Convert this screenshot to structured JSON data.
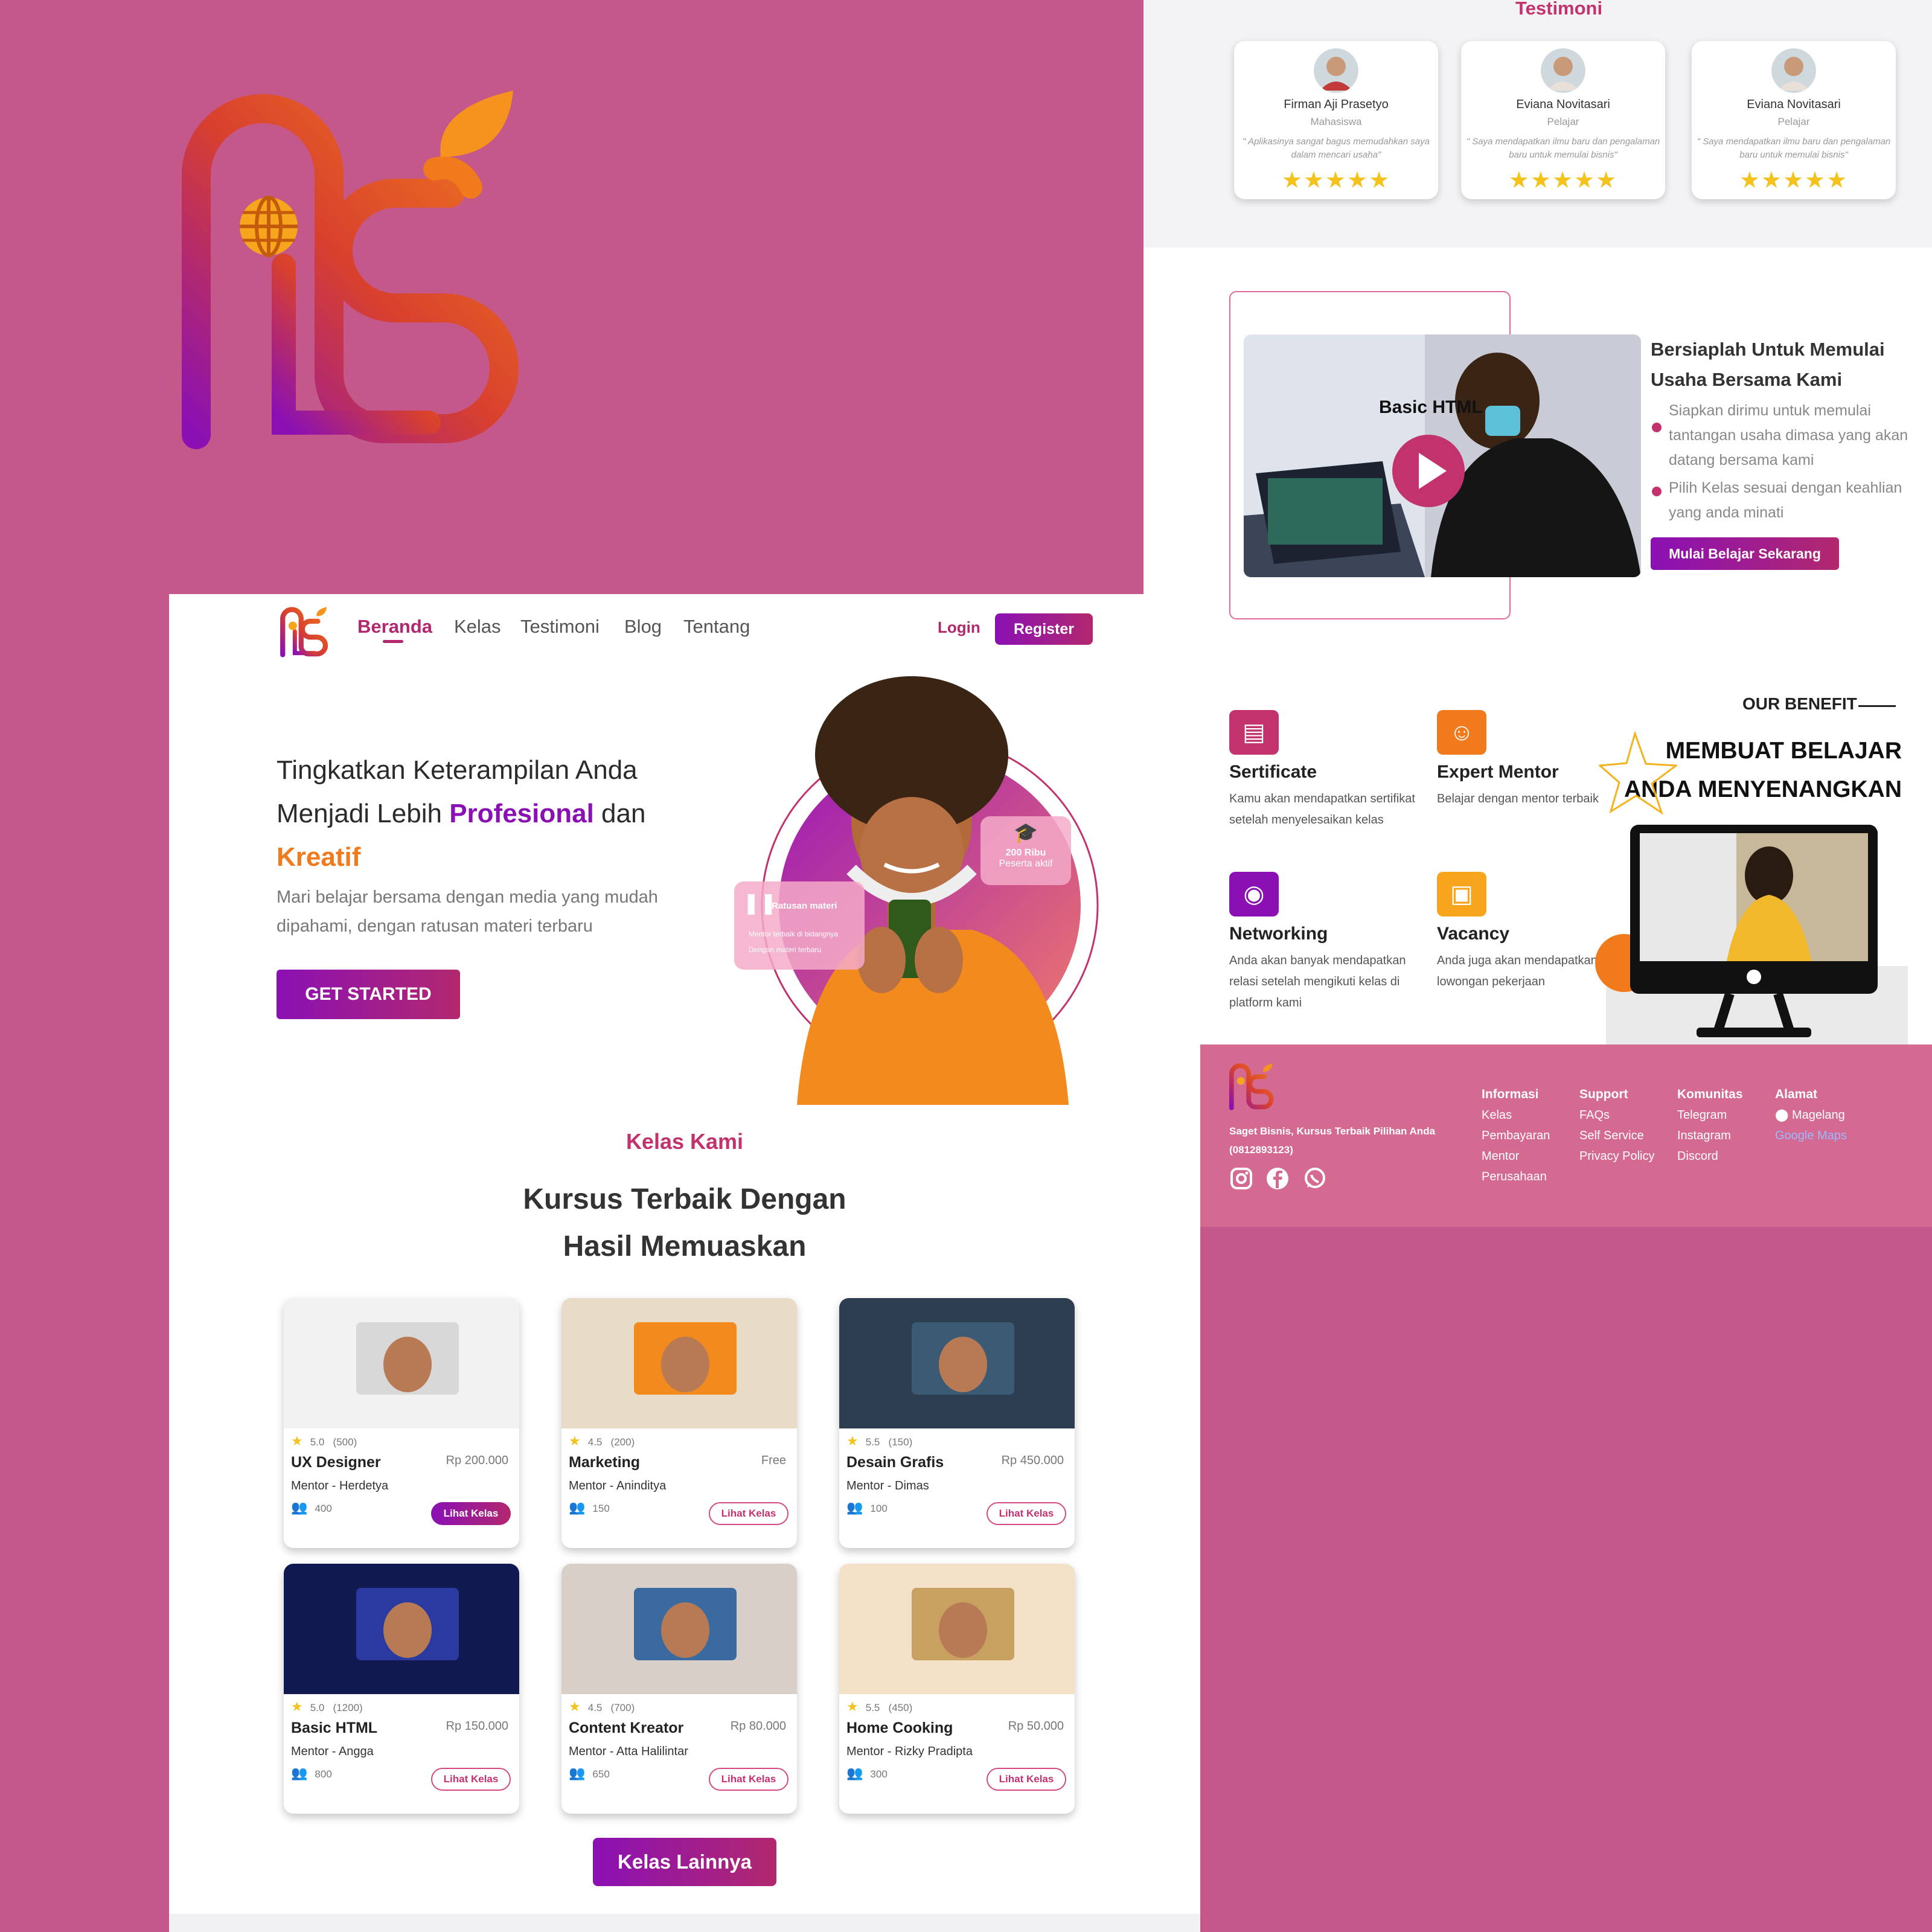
{
  "nav": {
    "items": [
      {
        "label": "Beranda",
        "active": true
      },
      {
        "label": "Kelas",
        "active": false
      },
      {
        "label": "Testimoni",
        "active": false
      },
      {
        "label": "Blog",
        "active": false
      },
      {
        "label": "Tentang",
        "active": false
      }
    ],
    "login": "Login",
    "register": "Register"
  },
  "hero": {
    "title_1": "Tingkatkan Keterampilan Anda",
    "title_2": "Menjadi Lebih ",
    "title_highlight_1": "Profesional",
    "title_3": " dan",
    "title_highlight_2": "Kreatif",
    "subtitle": "Mari  belajar bersama dengan media yang mudah dipahami, dengan ratusan materi terbaru",
    "cta": "GET STARTED",
    "float_materi": {
      "title": "Ratusan materi",
      "items": [
        "Mentor terbaik di bidangnya",
        "Dengan materi terbaru"
      ]
    },
    "float_peserta": {
      "title": "200 Ribu",
      "subtitle": "Peserta aktif"
    }
  },
  "kelas": {
    "kicker": "Kelas Kami",
    "title_1": "Kursus Terbaik Dengan",
    "title_2": "Hasil Memuaskan",
    "courses": [
      {
        "rating": "5.0",
        "reviews": "(500)",
        "name": "UX Designer",
        "price": "Rp 200.000",
        "mentor": "Mentor - Herdetya",
        "students": "400",
        "button": "Lihat Kelas"
      },
      {
        "rating": "4.5",
        "reviews": "(200)",
        "name": "Marketing",
        "price": "Free",
        "mentor": "Mentor - Aninditya",
        "students": "150",
        "button": "Lihat Kelas"
      },
      {
        "rating": "5.5",
        "reviews": "(150)",
        "name": "Desain Grafis",
        "price": "Rp 450.000",
        "mentor": "Mentor - Dimas",
        "students": "100",
        "button": "Lihat Kelas"
      },
      {
        "rating": "5.0",
        "reviews": "(1200)",
        "name": "Basic HTML",
        "price": "Rp 150.000",
        "mentor": "Mentor - Angga",
        "students": "800",
        "button": "Lihat Kelas"
      },
      {
        "rating": "4.5",
        "reviews": "(700)",
        "name": "Content Kreator",
        "price": "Rp 80.000",
        "mentor": "Mentor - Atta Halilintar",
        "students": "650",
        "button": "Lihat Kelas"
      },
      {
        "rating": "5.5",
        "reviews": "(450)",
        "name": "Home Cooking",
        "price": "Rp 50.000",
        "mentor": "Mentor - Rizky Pradipta",
        "students": "300",
        "button": "Lihat Kelas"
      }
    ],
    "more": "Kelas Lainnya"
  },
  "testimoni": {
    "heading": "Testimoni",
    "items": [
      {
        "name": "Firman Aji Prasetyo",
        "role": "Mahasiswa",
        "quote": "\" Aplikasinya sangat bagus memudahkan saya dalam mencari usaha\"",
        "stars": "★★★★★"
      },
      {
        "name": "Eviana Novitasari",
        "role": "Pelajar",
        "quote": "\" Saya mendapatkan ilmu baru dan pengalaman baru untuk memulai bisnis\"",
        "stars": "★★★★★"
      },
      {
        "name": "Eviana Novitasari",
        "role": "Pelajar",
        "quote": "\" Saya mendapatkan ilmu baru dan pengalaman baru untuk memulai bisnis\"",
        "stars": "★★★★★"
      }
    ]
  },
  "promo": {
    "video_label": "Basic HTML",
    "title": "Bersiaplah Untuk Memulai Usaha Bersama Kami",
    "bullets": [
      "Siapkan dirimu untuk memulai tantangan usaha dimasa yang akan datang bersama kami",
      "Pilih Kelas sesuai dengan keahlian yang anda minati"
    ],
    "cta": "Mulai Belajar Sekarang"
  },
  "benefit": {
    "kicker": "OUR BENEFIT",
    "title_1": "MEMBUAT BELAJAR",
    "title_2": "ANDA MENYENANGKAN",
    "items": [
      {
        "title": "Sertificate",
        "desc": "Kamu akan mendapatkan sertifikat setelah menyelesaikan kelas",
        "color": "#c2336e",
        "icon": "certificate-icon"
      },
      {
        "title": "Expert Mentor",
        "desc": "Belajar dengan mentor terbaik",
        "color": "#f07a1c",
        "icon": "mentor-icon"
      },
      {
        "title": "Networking",
        "desc": "Anda akan banyak mendapatkan relasi setelah mengikuti kelas di platform kami",
        "color": "#8a10b4",
        "icon": "wifi-icon"
      },
      {
        "title": "Vacancy",
        "desc": "Anda juga akan mendapatkan lowongan pekerjaan",
        "color": "#f6a51c",
        "icon": "briefcase-icon"
      }
    ]
  },
  "footer": {
    "tagline_1": "Saget Bisnis, Kursus Terbaik Pilihan Anda",
    "tagline_2": "(0812893123)",
    "columns": [
      {
        "heading": "Informasi",
        "links": [
          "Kelas",
          "Pembayaran",
          "Mentor",
          "Perusahaan"
        ]
      },
      {
        "heading": "Support",
        "links": [
          "FAQs",
          "Self Service",
          "Privacy Policy"
        ]
      },
      {
        "heading": "Komunitas",
        "links": [
          "Telegram",
          "Instagram",
          "Discord"
        ]
      }
    ],
    "alamat": {
      "heading": "Alamat",
      "city": "Magelang",
      "maps": "Google Maps"
    }
  },
  "colors": {
    "brand_purple": "#8a10b4",
    "brand_pink": "#c2336e",
    "brand_orange": "#f07a1c",
    "background": "#c4588a"
  }
}
